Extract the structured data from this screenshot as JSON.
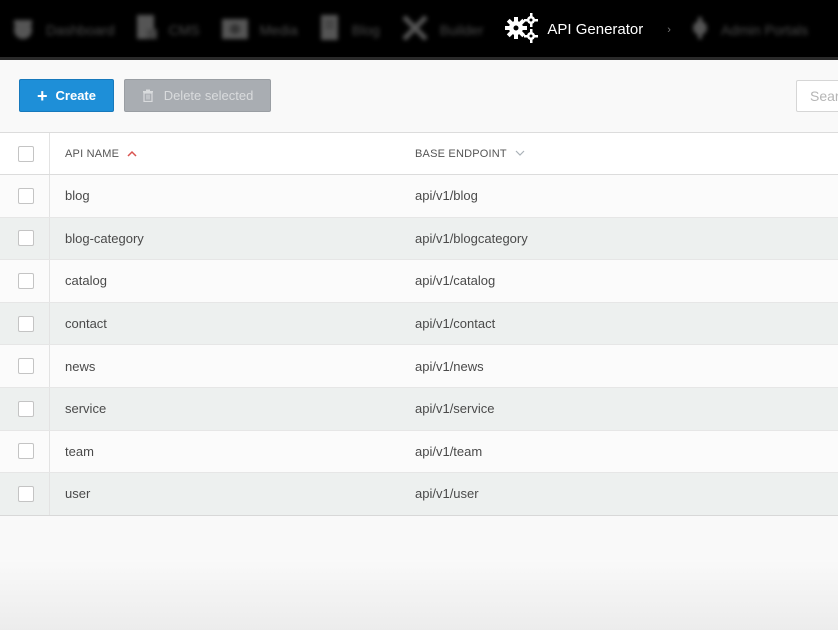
{
  "nav": {
    "items": [
      {
        "label": "Dashboard",
        "icon": "dashboard-icon"
      },
      {
        "label": "CMS",
        "icon": "cms-icon"
      },
      {
        "label": "Media",
        "icon": "media-icon"
      },
      {
        "label": "Blog",
        "icon": "blog-icon"
      },
      {
        "label": "Builder",
        "icon": "builder-icon"
      }
    ],
    "active": {
      "label": "API Generator",
      "icon": "gears-icon"
    },
    "after": {
      "label": "Admin Portals",
      "icon": "portal-icon"
    }
  },
  "toolbar": {
    "create_label": "Create",
    "delete_label": "Delete selected",
    "search_placeholder": "Search"
  },
  "table": {
    "columns": {
      "name": "API NAME",
      "endpoint": "BASE ENDPOINT"
    },
    "rows": [
      {
        "name": "blog",
        "endpoint": "api/v1/blog"
      },
      {
        "name": "blog-category",
        "endpoint": "api/v1/blogcategory"
      },
      {
        "name": "catalog",
        "endpoint": "api/v1/catalog"
      },
      {
        "name": "contact",
        "endpoint": "api/v1/contact"
      },
      {
        "name": "news",
        "endpoint": "api/v1/news"
      },
      {
        "name": "service",
        "endpoint": "api/v1/service"
      },
      {
        "name": "team",
        "endpoint": "api/v1/team"
      },
      {
        "name": "user",
        "endpoint": "api/v1/user"
      }
    ]
  },
  "colors": {
    "primary": "#1e8fd8",
    "disabled": "#a9adb2",
    "sort_active": "#d9534f",
    "nav_bg": "#000000"
  }
}
